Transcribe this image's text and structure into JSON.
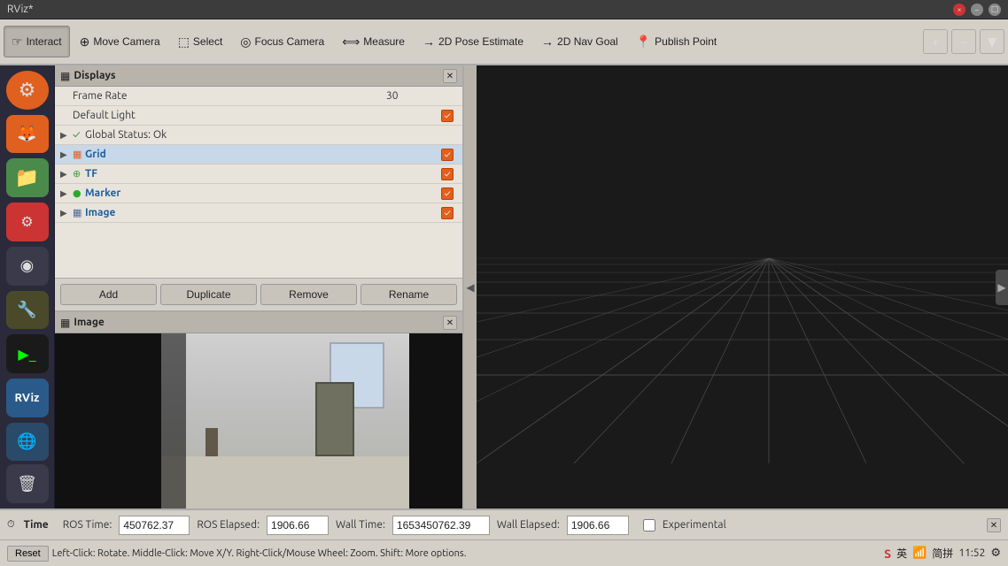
{
  "titlebar": {
    "title": "RViz*"
  },
  "toolbar": {
    "interact_label": "Interact",
    "move_camera_label": "Move Camera",
    "select_label": "Select",
    "focus_camera_label": "Focus Camera",
    "measure_label": "Measure",
    "pose_estimate_label": "2D Pose Estimate",
    "nav_goal_label": "2D Nav Goal",
    "publish_point_label": "Publish Point"
  },
  "displays_panel": {
    "title": "Displays",
    "items": [
      {
        "key": "Frame Rate",
        "value": "30",
        "has_checkbox": false,
        "checked": false,
        "indent": 1,
        "color": "normal"
      },
      {
        "key": "Default Light",
        "value": "",
        "has_checkbox": true,
        "checked": true,
        "indent": 1,
        "color": "normal"
      },
      {
        "key": "Global Status: Ok",
        "value": "",
        "has_checkbox": false,
        "checked": true,
        "indent": 0,
        "color": "green_check"
      },
      {
        "key": "Grid",
        "value": "",
        "has_checkbox": true,
        "checked": true,
        "indent": 0,
        "color": "blue",
        "has_arrow": true,
        "selected": true
      },
      {
        "key": "TF",
        "value": "",
        "has_checkbox": true,
        "checked": true,
        "indent": 0,
        "color": "blue",
        "has_arrow": true
      },
      {
        "key": "Marker",
        "value": "",
        "has_checkbox": true,
        "checked": true,
        "indent": 0,
        "color": "blue",
        "has_arrow": true
      },
      {
        "key": "Image",
        "value": "",
        "has_checkbox": true,
        "checked": true,
        "indent": 0,
        "color": "blue",
        "has_arrow": true
      }
    ],
    "buttons": {
      "add": "Add",
      "duplicate": "Duplicate",
      "remove": "Remove",
      "rename": "Rename"
    }
  },
  "image_panel": {
    "title": "Image"
  },
  "time_bar": {
    "ros_time_label": "ROS Time:",
    "ros_time_value": "450762.37",
    "ros_elapsed_label": "ROS Elapsed:",
    "ros_elapsed_value": "1906.66",
    "wall_time_label": "Wall Time:",
    "wall_time_value": "1653450762.39",
    "wall_elapsed_label": "Wall Elapsed:",
    "wall_elapsed_value": "1906.66",
    "experimental_label": "Experimental"
  },
  "status_bar": {
    "reset_label": "Reset",
    "help_text": "Left-Click: Rotate.  Middle-Click: Move X/Y.  Right-Click/Mouse Wheel: Zoom.  Shift: More options."
  },
  "time_panel": {
    "title": "Time"
  },
  "system_tray": {
    "time": "11:52"
  }
}
